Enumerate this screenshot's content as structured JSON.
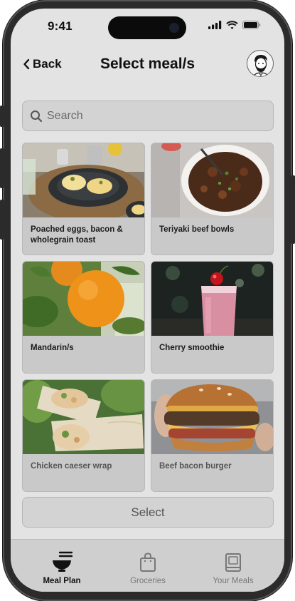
{
  "status_bar": {
    "time": "9:41"
  },
  "header": {
    "back_label": "Back",
    "title": "Select meal/s"
  },
  "search": {
    "placeholder": "Search"
  },
  "meals": [
    {
      "name": "Poached eggs, bacon & wholegrain toast"
    },
    {
      "name": "Teriyaki beef bowls"
    },
    {
      "name": "Mandarin/s"
    },
    {
      "name": "Cherry smoothie"
    },
    {
      "name": "Chicken caeser wrap"
    },
    {
      "name": "Beef bacon burger"
    }
  ],
  "select_button": {
    "label": "Select"
  },
  "tabs": [
    {
      "label": "Meal Plan",
      "icon": "bowl-icon",
      "active": true
    },
    {
      "label": "Groceries",
      "icon": "shopping-bag-icon",
      "active": false
    },
    {
      "label": "Your Meals",
      "icon": "book-icon",
      "active": false
    }
  ]
}
